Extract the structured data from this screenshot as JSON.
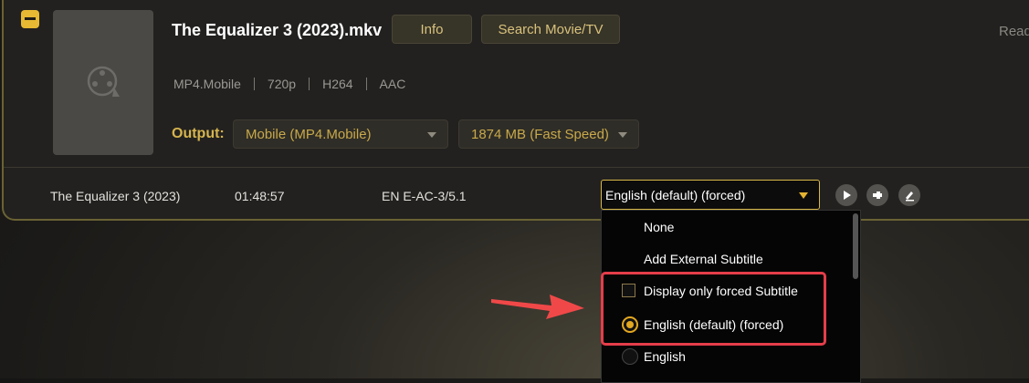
{
  "item": {
    "title": "The Equalizer 3 (2023).mkv",
    "buttons": {
      "info": "Info",
      "search": "Search Movie/TV"
    },
    "status": "Read",
    "meta": [
      "MP4.Mobile",
      "720p",
      "H264",
      "AAC"
    ],
    "output_label": "Output:",
    "output_format": "Mobile (MP4.Mobile)",
    "output_size": "1874 MB (Fast Speed)"
  },
  "track": {
    "name": "The Equalizer 3 (2023)",
    "duration": "01:48:57",
    "audio": "EN  E-AC-3/5.1",
    "subtitle_selected": "English (default) (forced)"
  },
  "subtitle_menu": {
    "items": [
      "None",
      "Add External Subtitle",
      "Display only forced Subtitle",
      "English (default) (forced)",
      "English"
    ]
  },
  "colors": {
    "accent": "#e3b231",
    "highlight": "#e53d4a",
    "label_gold": "#d6b44e"
  }
}
